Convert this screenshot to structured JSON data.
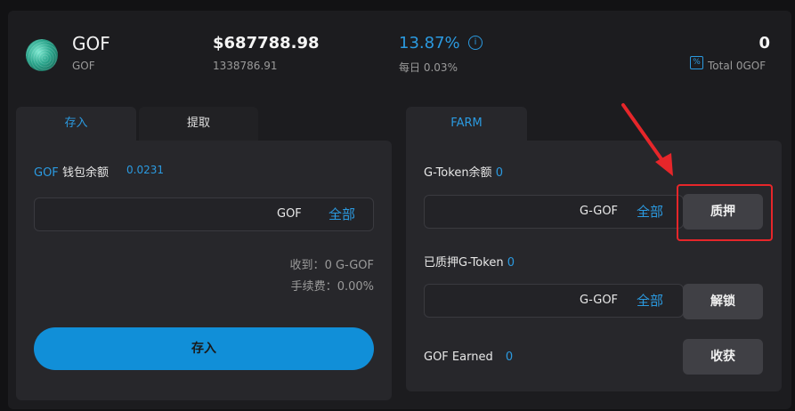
{
  "header": {
    "token_name": "GOF",
    "token_symbol": "GOF",
    "price": "$687788.98",
    "price_sub": "1338786.91",
    "apy": "13.87%",
    "daily_label": "每日",
    "daily_value": "0.03%",
    "total": "0",
    "total_sub": "Total 0GOF",
    "info_icon": "info-circle-icon",
    "percent_icon": "percent-square-icon"
  },
  "left_card": {
    "tabs": [
      {
        "label": "存入",
        "active": true
      },
      {
        "label": "提取",
        "active": false
      }
    ],
    "balance_token": "GOF",
    "balance_label": "钱包余额",
    "balance_value": "0.0231",
    "input_value": "",
    "input_unit": "GOF",
    "max_label": "全部",
    "receive_label": "收到：",
    "receive_value": "0 G-GOF",
    "fee_label": "手续费：",
    "fee_value": "0.00%",
    "submit_label": "存入"
  },
  "right_card": {
    "tab_label": "FARM",
    "gtoken_balance_label": "G-Token余额",
    "gtoken_balance_value": "0",
    "stake_input_value": "",
    "stake_unit": "G-GOF",
    "stake_max_label": "全部",
    "stake_button": "质押",
    "staked_label": "已质押G-Token",
    "staked_value": "0",
    "unstake_input_value": "",
    "unstake_unit": "G-GOF",
    "unstake_max_label": "全部",
    "unstake_button": "解锁",
    "earned_label": "GOF Earned",
    "earned_value": "0",
    "harvest_button": "收获"
  },
  "colors": {
    "accent": "#2b9ae0",
    "primary_button": "#118fd8",
    "highlight": "#e6262a"
  }
}
